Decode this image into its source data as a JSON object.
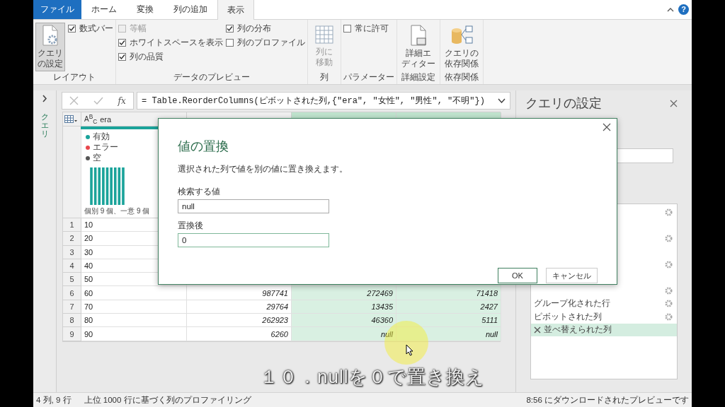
{
  "ribbon_tabs": [
    {
      "label": "ファイル",
      "kind": "file",
      "selected": false
    },
    {
      "label": "ホーム",
      "kind": "tab",
      "selected": false
    },
    {
      "label": "変換",
      "kind": "tab",
      "selected": false
    },
    {
      "label": "列の追加",
      "kind": "tab",
      "selected": false
    },
    {
      "label": "表示",
      "kind": "tab",
      "selected": true
    }
  ],
  "ribbon_help": "?",
  "ribbon_groups": [
    {
      "label": "レイアウト",
      "columns": [
        [
          {
            "kind": "large",
            "lines": [
              "クエリ",
              "の設定"
            ],
            "pressed": true,
            "disabled": false
          }
        ],
        [
          {
            "kind": "check",
            "label": "数式バー",
            "checked": true,
            "disabled": false
          }
        ]
      ]
    },
    {
      "label": "データのプレビュー",
      "columns": [
        [
          {
            "kind": "check",
            "label": "等幅",
            "checked": false,
            "disabled": true
          },
          {
            "kind": "check",
            "label": "ホワイトスペースを表示",
            "checked": true,
            "disabled": false
          },
          {
            "kind": "check",
            "label": "列の品質",
            "checked": true,
            "disabled": false
          }
        ],
        [
          {
            "kind": "check",
            "label": "列の分布",
            "checked": true,
            "disabled": false
          },
          {
            "kind": "check",
            "label": "列のプロファイル",
            "checked": false,
            "disabled": false
          }
        ]
      ]
    },
    {
      "label": "列",
      "columns": [
        [
          {
            "kind": "large",
            "lines": [
              "列に",
              "移動"
            ],
            "pressed": false,
            "disabled": true
          }
        ]
      ]
    },
    {
      "label": "パラメーター",
      "columns": [
        [
          {
            "kind": "check",
            "label": "常に許可",
            "checked": false,
            "disabled": false
          }
        ]
      ]
    },
    {
      "label": "詳細設定",
      "columns": [
        [
          {
            "kind": "large",
            "lines": [
              "詳細エ",
              "ディター"
            ],
            "pressed": false,
            "disabled": false
          }
        ]
      ]
    },
    {
      "label": "依存関係",
      "columns": [
        [
          {
            "kind": "large",
            "lines": [
              "クエリの",
              "依存関係"
            ],
            "pressed": false,
            "disabled": false
          }
        ]
      ]
    }
  ],
  "queries_pane": {
    "label": "クエリ",
    "expanded": false
  },
  "formula_bar": {
    "fx": "fx",
    "formula": "= Table.ReorderColumns(ピボットされた列,{\"era\", \"女性\", \"男性\", \"不明\"})"
  },
  "table": {
    "columns": [
      {
        "type": "A$^{B}$$_{C}$",
        "name": "era",
        "selected": false
      },
      {
        "selected": false
      },
      {
        "selected": true
      },
      {
        "selected": true
      }
    ],
    "profile": {
      "legend": [
        {
          "label": "有効",
          "color": "#1aa39a"
        },
        {
          "label": "エラー",
          "color": "#e8474c"
        },
        {
          "label": "空",
          "color": "#555555"
        }
      ],
      "summary": "個別 9 個、一意 9 個"
    },
    "rows": [
      {
        "index": "1",
        "cells": [
          {
            "text": "10",
            "kind": "text"
          }
        ]
      },
      {
        "index": "2",
        "cells": [
          {
            "text": "20",
            "kind": "text"
          }
        ]
      },
      {
        "index": "3",
        "cells": [
          {
            "text": "30",
            "kind": "text"
          }
        ]
      },
      {
        "index": "4",
        "cells": [
          {
            "text": "40",
            "kind": "text"
          }
        ]
      },
      {
        "index": "5",
        "cells": [
          {
            "text": "50",
            "kind": "text"
          }
        ]
      },
      {
        "index": "6",
        "cells": [
          {
            "text": "60",
            "kind": "text"
          },
          {
            "text": "987741",
            "kind": "number"
          },
          {
            "text": "272469",
            "kind": "number"
          },
          {
            "text": "71418",
            "kind": "number"
          }
        ]
      },
      {
        "index": "7",
        "cells": [
          {
            "text": "70",
            "kind": "text"
          },
          {
            "text": "29764",
            "kind": "number"
          },
          {
            "text": "13435",
            "kind": "number"
          },
          {
            "text": "2427",
            "kind": "number"
          }
        ]
      },
      {
        "index": "8",
        "cells": [
          {
            "text": "80",
            "kind": "text"
          },
          {
            "text": "262923",
            "kind": "number"
          },
          {
            "text": "46360",
            "kind": "number"
          },
          {
            "text": "5111",
            "kind": "number"
          }
        ]
      },
      {
        "index": "9",
        "cells": [
          {
            "text": "90",
            "kind": "text"
          },
          {
            "text": "6260",
            "kind": "number"
          },
          {
            "text": "null",
            "kind": "null"
          },
          {
            "text": "null",
            "kind": "null"
          }
        ]
      }
    ]
  },
  "query_settings": {
    "title": "クエリの設定",
    "steps": [
      {
        "settings": true,
        "selected": false
      },
      {
        "settings": false,
        "selected": false
      },
      {
        "settings": true,
        "selected": false
      },
      {
        "settings": false,
        "selected": false
      },
      {
        "settings": true,
        "selected": false
      },
      {
        "settings": false,
        "selected": false
      },
      {
        "settings": true,
        "selected": false
      },
      {
        "label": "グループ化された行",
        "settings": true,
        "selected": false
      },
      {
        "label": "ピボットされた列",
        "settings": true,
        "selected": false
      },
      {
        "label": "並べ替えられた列",
        "settings": false,
        "selected": true
      }
    ]
  },
  "dialog": {
    "title": "値の置換",
    "description": "選択された列で値を別の値に置き換えます。",
    "fields": [
      {
        "label": "検索する値",
        "value": "null",
        "focused": false
      },
      {
        "label": "置換後",
        "value": "0",
        "focused": true
      }
    ],
    "buttons": [
      {
        "label": "OK",
        "kind": "primary"
      },
      {
        "label": "キャンセル",
        "kind": "secondary"
      }
    ]
  },
  "status_bar": {
    "left": [
      "4 列, 9 行",
      "上位 1000 行に基づく列のプロファイリング"
    ],
    "right": "8:56 にダウンロードされたプレビューです"
  },
  "caption": "１０．nullを０で置き換え"
}
